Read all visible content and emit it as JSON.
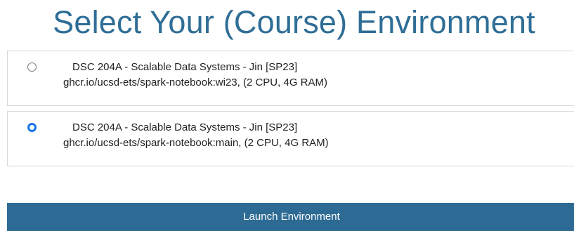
{
  "page": {
    "title": "Select Your (Course) Environment"
  },
  "options": [
    {
      "title": "DSC 204A - Scalable Data Systems - Jin [SP23]",
      "image": "ghcr.io/ucsd-ets/spark-notebook:wi23, (2 CPU, 4G RAM)",
      "selected": false
    },
    {
      "title": "DSC 204A - Scalable Data Systems - Jin [SP23]",
      "image": "ghcr.io/ucsd-ets/spark-notebook:main, (2 CPU, 4G RAM)",
      "selected": true
    }
  ],
  "actions": {
    "launch_label": "Launch Environment"
  },
  "colors": {
    "title": "#2f6e96",
    "button": "#2e6b94",
    "radio_selected": "#1a73e8"
  }
}
